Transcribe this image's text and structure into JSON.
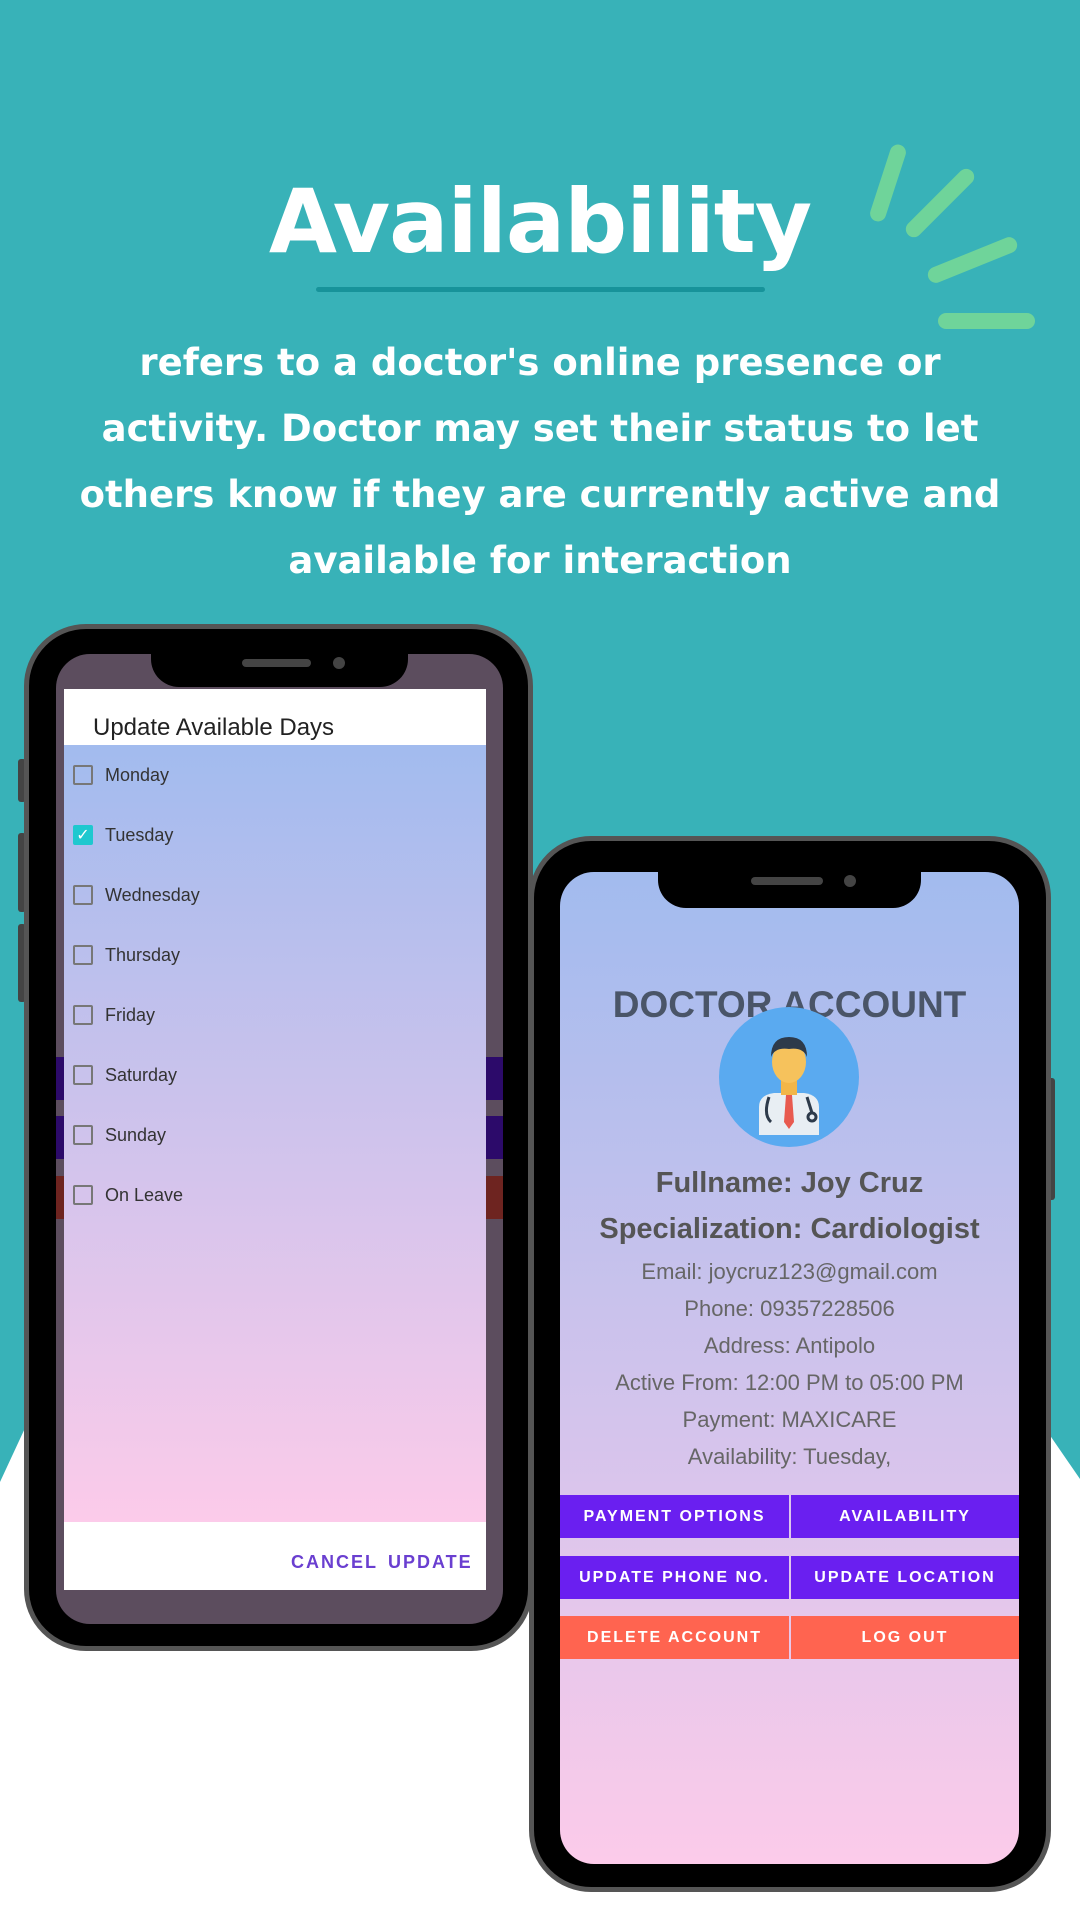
{
  "hero": {
    "title": "Availability",
    "description": "refers to a doctor's online presence or\nactivity. Doctor may set their status   to let\nothers know if they are currently active and\navailable for interaction"
  },
  "colors": {
    "background": "#38b2b8",
    "accent_green": "#6fd49a",
    "purple_button": "#6a1ff0",
    "coral_button": "#ff6450",
    "dialog_action": "#6a3fd0",
    "checkbox_checked": "#1ec8cf"
  },
  "dialog": {
    "title": "Update Available Days",
    "days": [
      {
        "label": "Monday",
        "checked": false
      },
      {
        "label": "Tuesday",
        "checked": true
      },
      {
        "label": "Wednesday",
        "checked": false
      },
      {
        "label": "Thursday",
        "checked": false
      },
      {
        "label": "Friday",
        "checked": false
      },
      {
        "label": "Saturday",
        "checked": false
      },
      {
        "label": "Sunday",
        "checked": false
      },
      {
        "label": "On Leave",
        "checked": false
      }
    ],
    "cancel": "CANCEL",
    "update": "UPDATE"
  },
  "account": {
    "heading": "DOCTOR ACCOUNT",
    "avatar_icon": "doctor-avatar-icon",
    "fullname": "Fullname: Joy Cruz",
    "specialization": "Specialization: Cardiologist",
    "email": "Email: joycruz123@gmail.com",
    "phone": "Phone: 09357228506",
    "address": "Address: Antipolo",
    "active": "Active From: 12:00 PM to 05:00 PM",
    "payment": "Payment: MAXICARE",
    "availability": "Availability: Tuesday,",
    "buttons": {
      "payment_options": "PAYMENT OPTIONS",
      "availability": "AVAILABILITY",
      "update_phone": "UPDATE PHONE NO.",
      "update_location": "UPDATE LOCATION",
      "delete_account": "DELETE ACCOUNT",
      "log_out": "LOG OUT"
    }
  }
}
